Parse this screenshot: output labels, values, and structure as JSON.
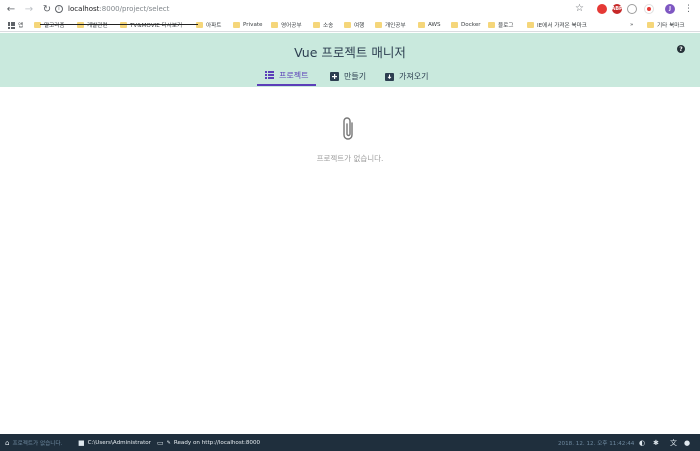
{
  "browser": {
    "url_host": "localhost",
    "url_rest": ":8000/project/select",
    "extensions": [
      {
        "name": "opera-icon",
        "color": "#e53935",
        "label": ""
      },
      {
        "name": "adblock-icon",
        "color": "#c62828",
        "label": "ABP"
      },
      {
        "name": "extension-icon",
        "color": "#9e9e9e",
        "label": ""
      },
      {
        "name": "ext-red-icon",
        "color": "#e53935",
        "label": ""
      },
      {
        "name": "profile-avatar",
        "color": "#7e57c2",
        "label": "J"
      }
    ]
  },
  "bookmarks": {
    "apps_label": "앱",
    "items": [
      "알고리즘",
      "개발관련",
      "TV&MOVIE 다시보기",
      "아파트",
      "Private",
      "영어공부",
      "소송",
      "여행",
      "개인공부",
      "AWS",
      "Docker",
      "블로그",
      "IE에서 가져온 북마크"
    ],
    "overflow": "»",
    "other": "기타 북마크"
  },
  "app": {
    "title_prefix": "Vue",
    "title_main": " 프로젝트 매니저",
    "help": "?",
    "tabs": [
      {
        "label": "프로젝트",
        "icon": "list-icon"
      },
      {
        "label": "만들기",
        "icon": "plus-icon"
      },
      {
        "label": "가져오기",
        "icon": "import-icon"
      }
    ],
    "empty_message": "프로젝트가 없습니다."
  },
  "taskbar": {
    "left_status": "프로젝트가 없습니다.",
    "folder": "C:\\Users\\Administrator",
    "ready": "Ready on http://localhost:8000",
    "datetime": "2018. 12. 12. 오후 11:42:44"
  },
  "colors": {
    "header_bg": "#c9e9dd",
    "accent": "#5b3fb8",
    "taskbar_bg": "#1f2f3d"
  }
}
